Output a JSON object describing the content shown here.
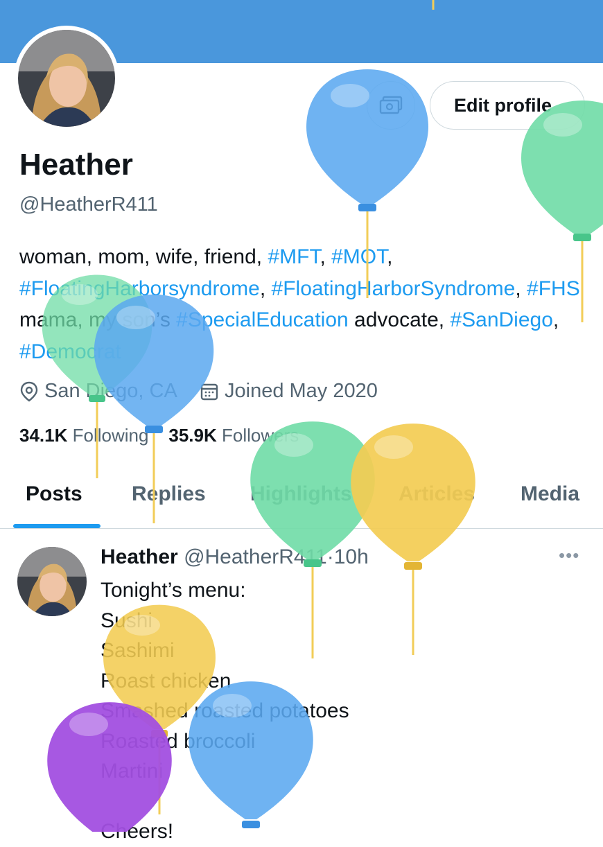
{
  "profile": {
    "name": "Heather",
    "handle": "@HeatherR411",
    "edit_label": "Edit profile",
    "bio": [
      {
        "text": "woman, mom, wife, friend, ",
        "tag": false
      },
      {
        "text": "#MFT",
        "tag": true
      },
      {
        "text": ", ",
        "tag": false
      },
      {
        "text": "#MOT",
        "tag": true
      },
      {
        "text": ", ",
        "tag": false
      },
      {
        "text": "#FloatingHarborsyndrome",
        "tag": true
      },
      {
        "text": ", ",
        "tag": false
      },
      {
        "text": "#FloatingHarborSyndrome",
        "tag": true
      },
      {
        "text": ", ",
        "tag": false
      },
      {
        "text": "#FHS",
        "tag": true
      },
      {
        "text": " mama, my son’s ",
        "tag": false
      },
      {
        "text": "#SpecialEducation",
        "tag": true
      },
      {
        "text": " advocate, ",
        "tag": false
      },
      {
        "text": "#SanDiego",
        "tag": true
      },
      {
        "text": ", ",
        "tag": false
      },
      {
        "text": "#Democrat",
        "tag": true
      }
    ],
    "location": "San Diego, CA",
    "joined": "Joined May 2020",
    "following_count": "34.1K",
    "following_label": "Following",
    "followers_count": "35.9K",
    "followers_label": "Followers"
  },
  "tabs": [
    "Posts",
    "Replies",
    "Highlights",
    "Articles",
    "Media"
  ],
  "active_tab": "Posts",
  "post": {
    "name": "Heather",
    "handle": "@HeatherR411",
    "separator": "·",
    "time": "10h",
    "more": "•••",
    "lines": [
      "Tonight’s menu:",
      "Sushi",
      "Sashimi",
      "Roast chicken",
      "Smashed roasted potatoes",
      "Roasted broccoli",
      "Martini",
      "",
      "Cheers!"
    ]
  },
  "icons": {
    "location": "location-pin-icon",
    "joined": "calendar-icon",
    "subscribe": "money-icon",
    "more": "more-dots-icon"
  },
  "colors": {
    "banner": "#4a97dc",
    "accent": "#1d9bf0",
    "muted": "#536471",
    "balloon_blue": "#5ba8f0",
    "balloon_green": "#6fdca6",
    "balloon_yellow": "#f3cc52",
    "balloon_purple": "#a24fe0"
  }
}
